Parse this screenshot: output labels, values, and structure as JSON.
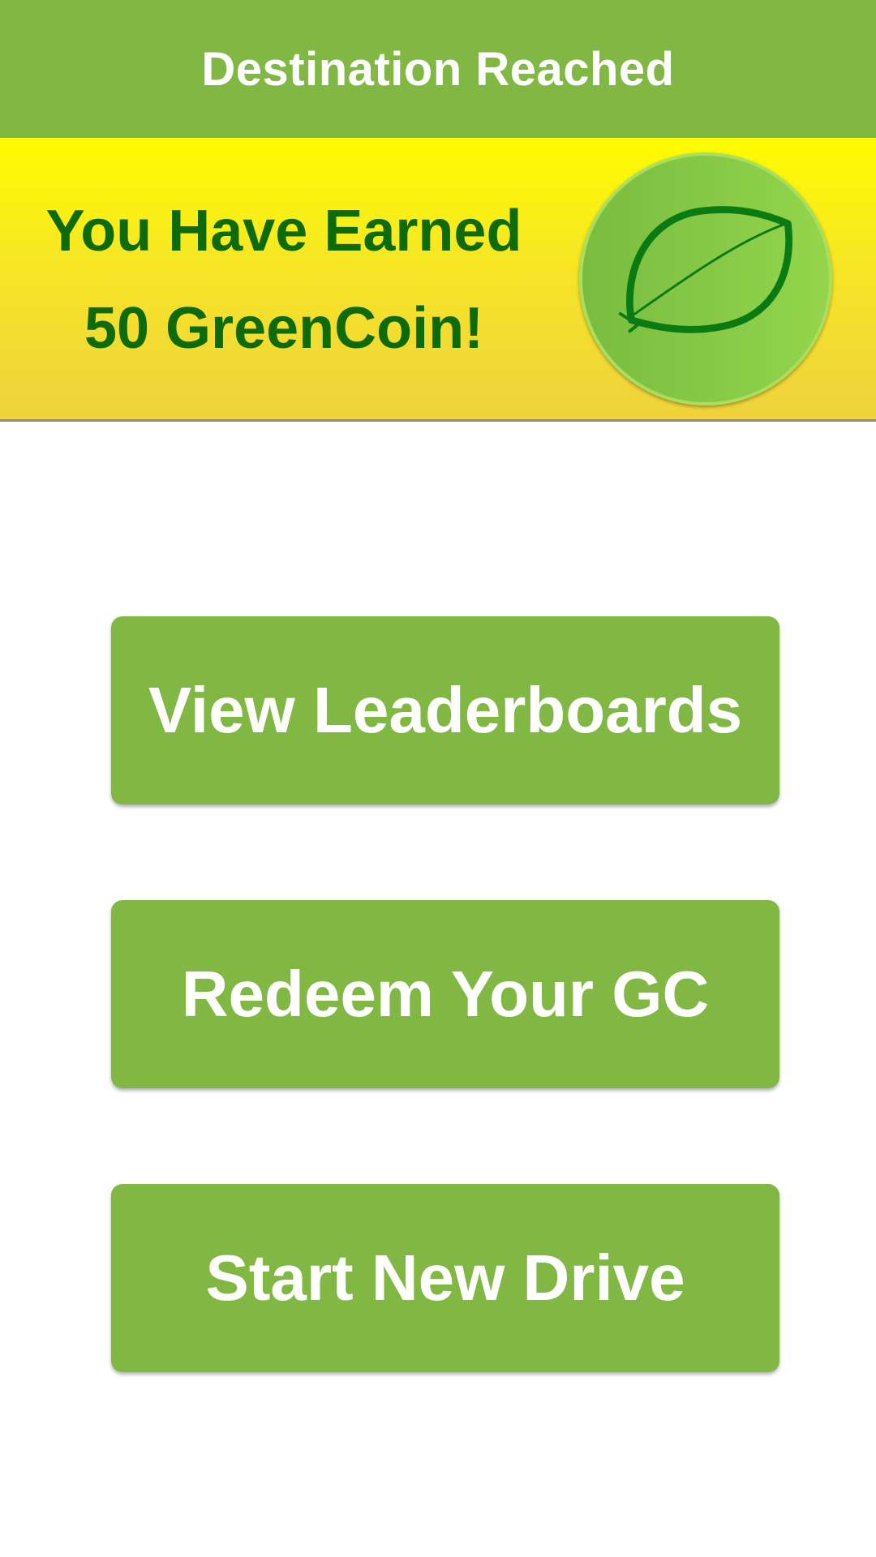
{
  "header": {
    "title": "Destination Reached"
  },
  "reward": {
    "line1": "You Have Earned",
    "line2": "50 GreenCoin!",
    "amount": 50,
    "currency": "GreenCoin",
    "icon": "leaf-icon"
  },
  "actions": {
    "view_leaderboards": "View Leaderboards",
    "redeem": "Redeem Your GC",
    "start_new_drive": "Start New Drive"
  },
  "colors": {
    "primary_green": "#80b843",
    "banner_yellow": "#fffc00",
    "text_dark_green": "#0d6b0a",
    "leaf_dark_green": "#0a7a12"
  }
}
